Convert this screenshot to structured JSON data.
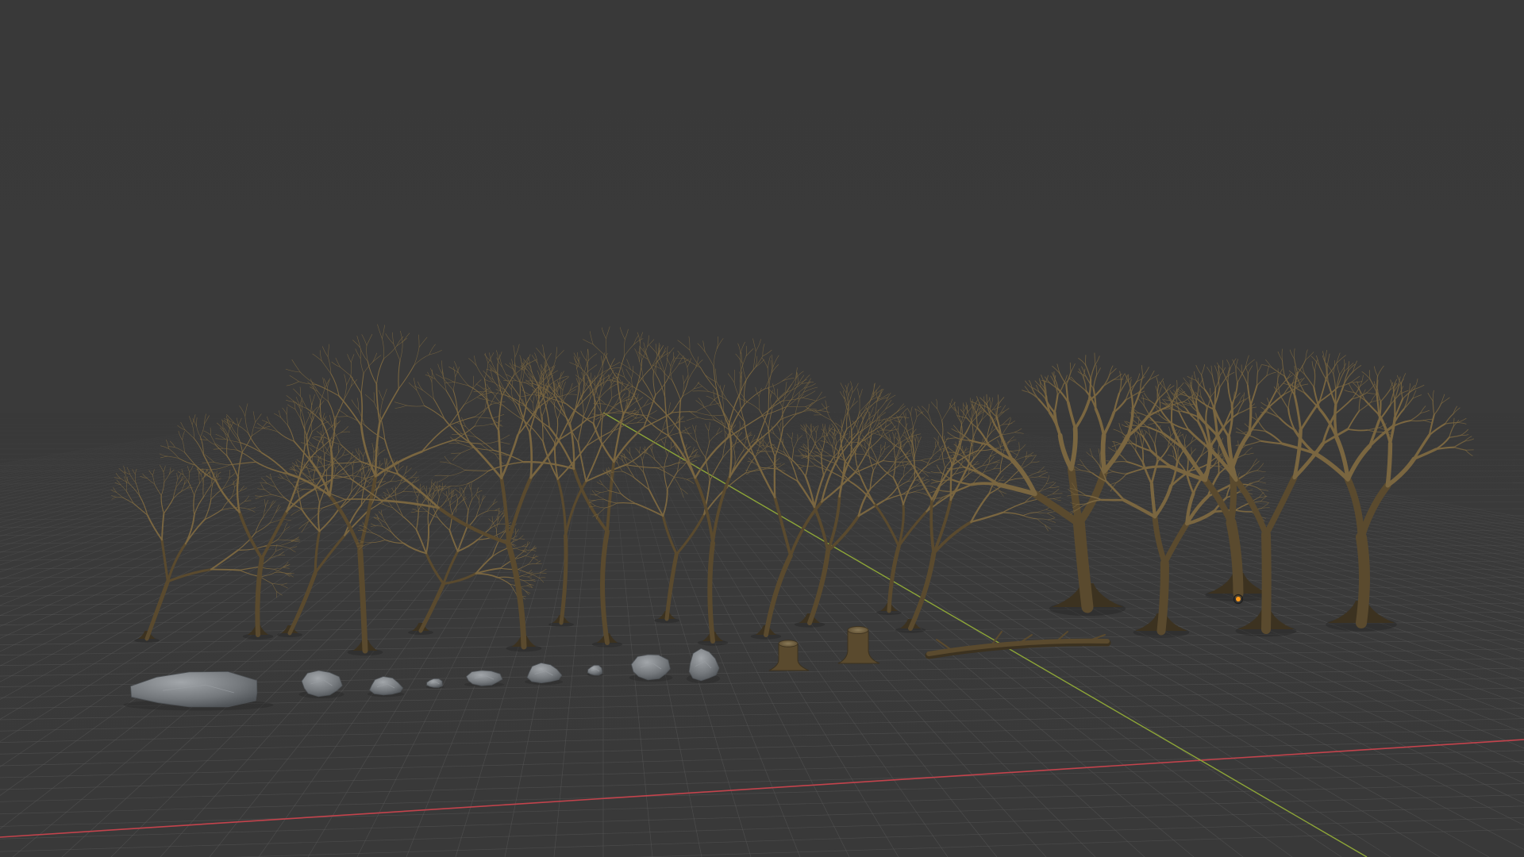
{
  "viewport": {
    "colors": {
      "background_top": "#3a3a3a",
      "background_horizon": "#393939",
      "grid_line": "#5b5b5b",
      "grid_line_minor": "#4a4a4a",
      "x_axis": "#c3434c",
      "y_axis": "#8da537",
      "tree_bark": "#5a4a2e",
      "tree_bark_light": "#7a6640",
      "tree_bark_dark": "#3c3220",
      "rock": "#74787c",
      "rock_light": "#9a9ea2",
      "rock_dark": "#4e5256",
      "light_marker": "#ff9a1a"
    },
    "icons": {
      "light_marker": "point-light-icon"
    }
  }
}
